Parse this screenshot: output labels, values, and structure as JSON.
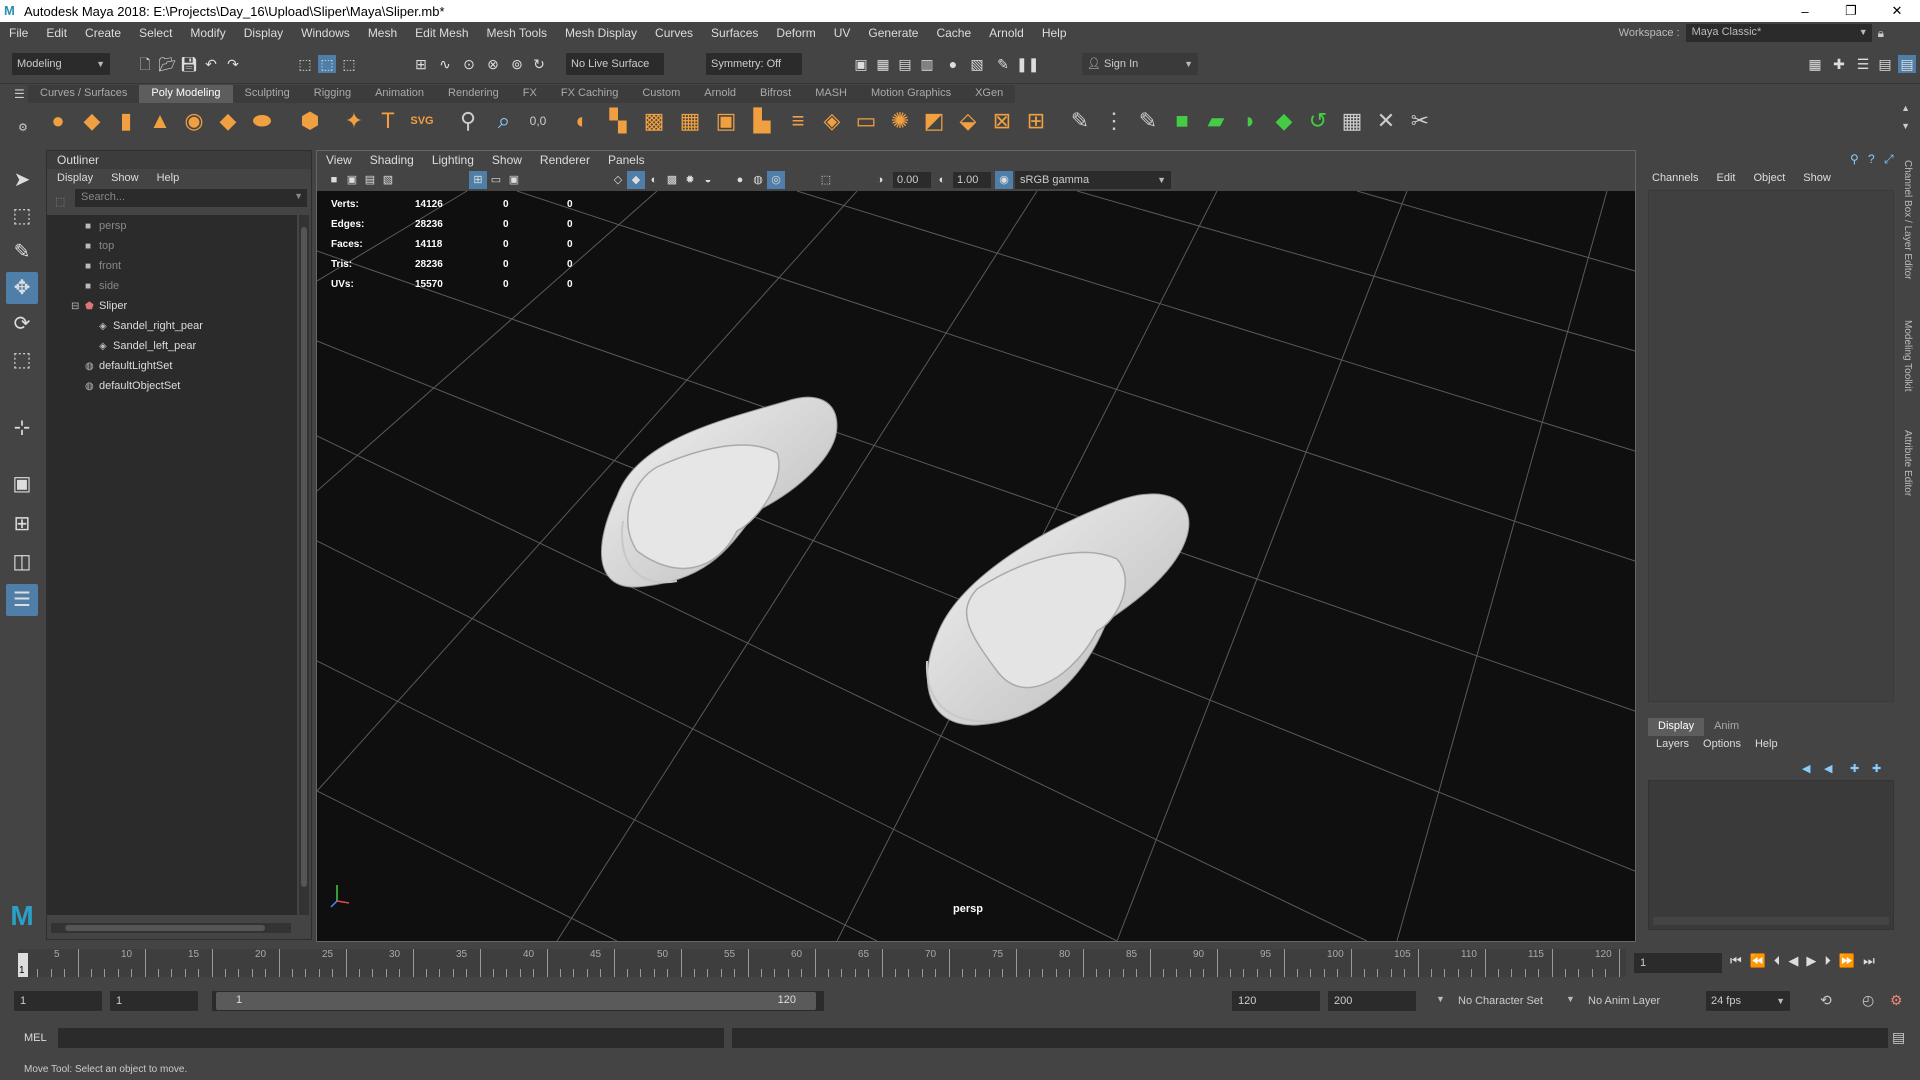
{
  "app": {
    "title": "Autodesk Maya 2018: E:\\Projects\\Day_16\\Upload\\Sliper\\Maya\\Sliper.mb*",
    "window_buttons": [
      "–",
      "❐",
      "✕"
    ]
  },
  "menubar": {
    "items": [
      "File",
      "Edit",
      "Create",
      "Select",
      "Modify",
      "Display",
      "Windows",
      "Mesh",
      "Edit Mesh",
      "Mesh Tools",
      "Mesh Display",
      "Curves",
      "Surfaces",
      "Deform",
      "UV",
      "Generate",
      "Cache",
      "Arnold",
      "Help"
    ],
    "workspace_label": "Workspace :",
    "workspace_value": "Maya Classic*"
  },
  "statusline": {
    "mode": "Modeling",
    "live_surface": "No Live Surface",
    "symmetry": "Symmetry: Off",
    "sign_in": "Sign In"
  },
  "shelf": {
    "tabs": [
      "Curves / Surfaces",
      "Poly Modeling",
      "Sculpting",
      "Rigging",
      "Animation",
      "Rendering",
      "FX",
      "FX Caching",
      "Custom",
      "Arnold",
      "Bifrost",
      "MASH",
      "Motion Graphics",
      "XGen"
    ],
    "active_tab": "Poly Modeling"
  },
  "outliner": {
    "title": "Outliner",
    "menu": [
      "Display",
      "Show",
      "Help"
    ],
    "search_placeholder": "Search...",
    "items": [
      {
        "label": "persp",
        "icon": "camera-icon"
      },
      {
        "label": "top",
        "icon": "camera-icon"
      },
      {
        "label": "front",
        "icon": "camera-icon"
      },
      {
        "label": "side",
        "icon": "camera-icon"
      },
      {
        "label": "Sliper",
        "icon": "group-icon"
      },
      {
        "label": "Sandel_right_pear",
        "icon": "mesh-icon"
      },
      {
        "label": "Sandel_left_pear",
        "icon": "mesh-icon"
      },
      {
        "label": "defaultLightSet",
        "icon": "set-icon"
      },
      {
        "label": "defaultObjectSet",
        "icon": "set-icon"
      }
    ]
  },
  "viewport": {
    "menu": [
      "View",
      "Shading",
      "Lighting",
      "Show",
      "Renderer",
      "Panels"
    ],
    "exposure": "0.00",
    "gamma": "1.00",
    "color_space": "sRGB gamma",
    "camera": "persp",
    "hud": [
      {
        "label": "Verts:",
        "value": "14126",
        "a": "0",
        "b": "0"
      },
      {
        "label": "Edges:",
        "value": "28236",
        "a": "0",
        "b": "0"
      },
      {
        "label": "Faces:",
        "value": "14118",
        "a": "0",
        "b": "0"
      },
      {
        "label": "Tris:",
        "value": "28236",
        "a": "0",
        "b": "0"
      },
      {
        "label": "UVs:",
        "value": "15570",
        "a": "0",
        "b": "0"
      }
    ]
  },
  "channelbox": {
    "menu": [
      "Channels",
      "Edit",
      "Object",
      "Show"
    ],
    "layer_tabs": [
      "Display",
      "Anim"
    ],
    "layer_menu": [
      "Layers",
      "Options",
      "Help"
    ],
    "side_tabs": [
      "Channel Box / Layer Editor",
      "Modeling Toolkit",
      "Attribute Editor"
    ]
  },
  "timeslider": {
    "ticks": [
      "5",
      "10",
      "15",
      "20",
      "25",
      "30",
      "35",
      "40",
      "45",
      "50",
      "55",
      "60",
      "65",
      "70",
      "75",
      "80",
      "85",
      "90",
      "95",
      "100",
      "105",
      "110",
      "115",
      "120"
    ],
    "current_frame": "1",
    "current_frame_field": "1"
  },
  "rangeslider": {
    "start": "1",
    "start_inner": "1",
    "range_start": "1",
    "range_end": "120",
    "end_inner": "120",
    "end": "200",
    "character_set": "No Character Set",
    "anim_layer": "No Anim Layer",
    "fps": "24 fps"
  },
  "cmdline": {
    "label": "MEL"
  },
  "helpline": {
    "text": "Move Tool: Select an object to move."
  }
}
